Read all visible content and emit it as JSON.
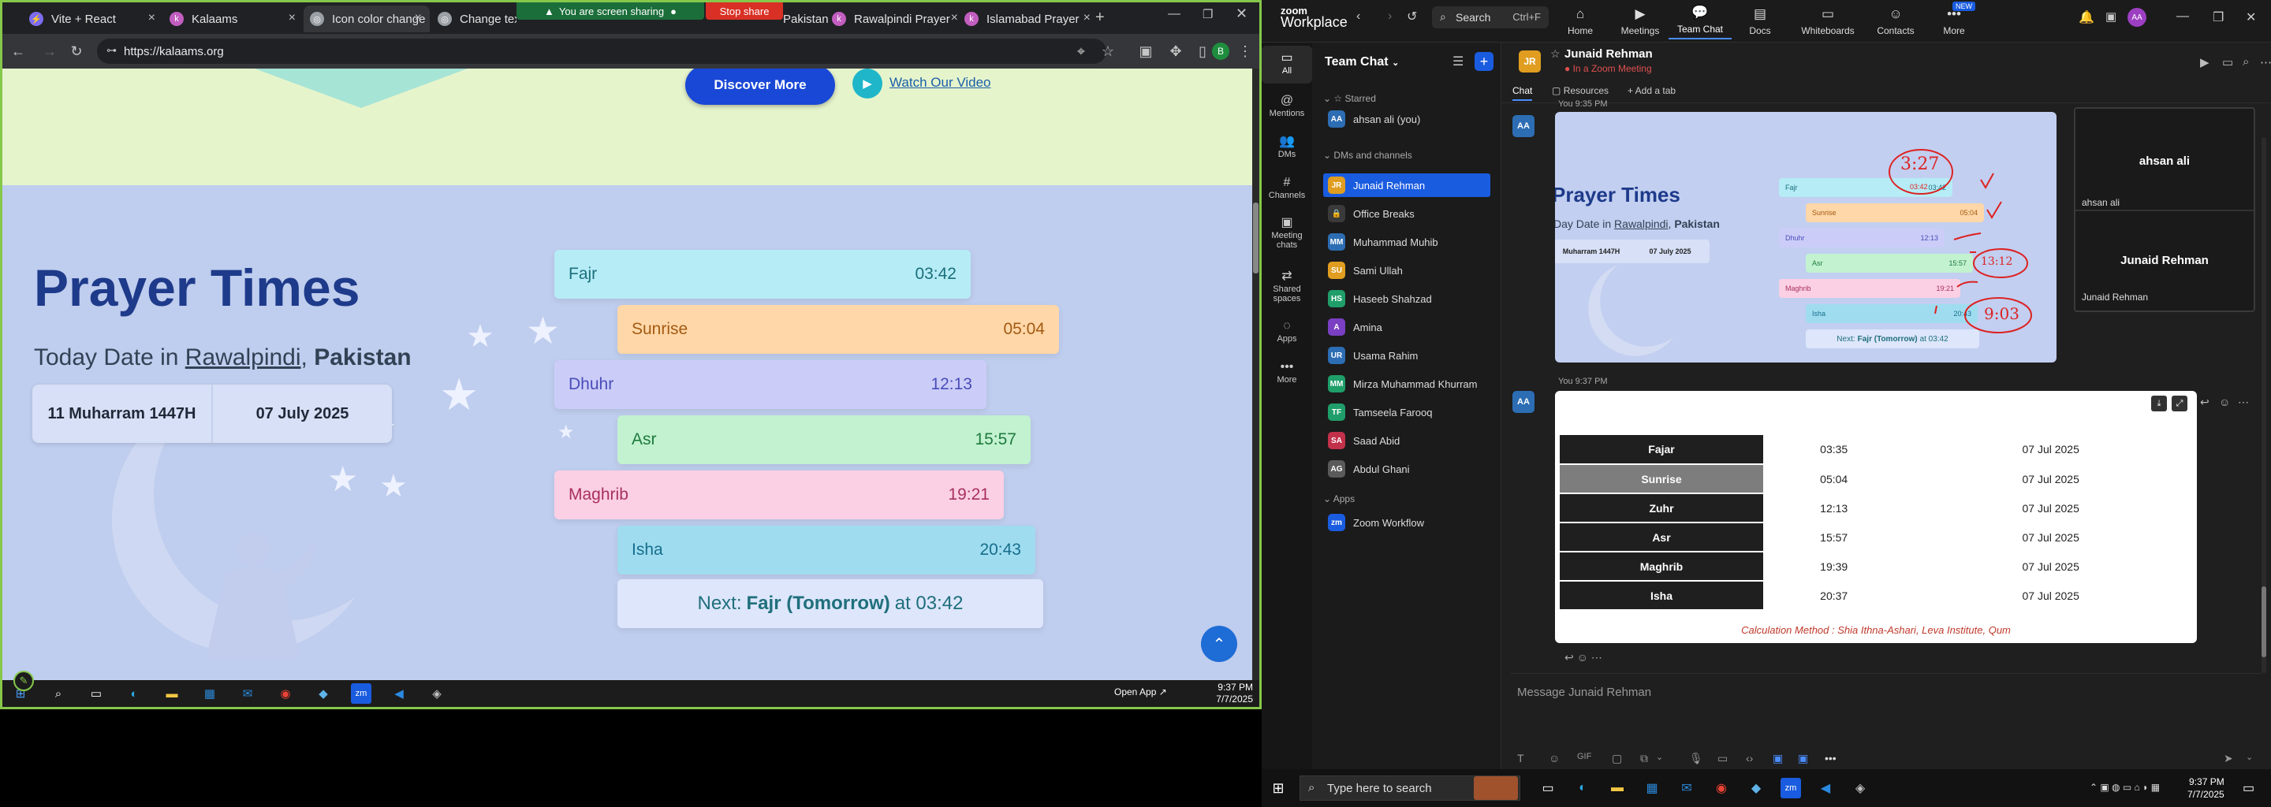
{
  "browser": {
    "tabs": [
      {
        "title": "Vite + React",
        "color": "#7c6cf0"
      },
      {
        "title": "Kalaams",
        "color": "#c25ec0"
      },
      {
        "title": "Icon color change",
        "color": "#9aa0a6"
      },
      {
        "title": "Change text color",
        "color": "#9aa0a6"
      },
      {
        "title": "Pakistan Prayer Ti",
        "color": "#9aa0a6"
      },
      {
        "title": "Rawalpindi Prayer",
        "color": "#c25ec0"
      },
      {
        "title": "Islamabad Prayer",
        "color": "#c25ec0"
      }
    ],
    "sharing_text": "You are screen sharing",
    "stop_share": "Stop share",
    "url": "https://kalaams.org",
    "profile_initial": "B"
  },
  "page": {
    "discover_btn": "Discover More",
    "watch_video": "Watch Our Video",
    "title": "Prayer Times",
    "date_prefix": "Today Date in ",
    "city": "Rawalpindi",
    "comma": ", ",
    "country": "Pakistan",
    "hijri": "11 Muharram 1447H",
    "greg": "07 July 2025",
    "prayers": [
      {
        "name": "Fajr",
        "time": "03:42",
        "bg": "#b6ecf5",
        "color": "#1a6f7c"
      },
      {
        "name": "Sunrise",
        "time": "05:04",
        "bg": "#ffd7a8",
        "color": "#a35a12"
      },
      {
        "name": "Dhuhr",
        "time": "12:13",
        "bg": "#cbcdf8",
        "color": "#4a4db8"
      },
      {
        "name": "Asr",
        "time": "15:57",
        "bg": "#c2f2d0",
        "color": "#1f7a3d"
      },
      {
        "name": "Maghrib",
        "time": "19:21",
        "bg": "#fbd0e4",
        "color": "#a8305f"
      },
      {
        "name": "Isha",
        "time": "20:43",
        "bg": "#9fdcef",
        "color": "#166e8c"
      }
    ],
    "next_label": "Next: ",
    "next_prayer": "Fajr (Tomorrow)",
    "next_at": " at 03:42"
  },
  "left_taskbar": {
    "time": "9:37 PM",
    "date": "7/7/2025",
    "open_app": "Open App ↗"
  },
  "zoom": {
    "brand_top": "zoom",
    "brand": "Workplace",
    "search": "Search",
    "search_shortcut": "Ctrl+F",
    "nav": [
      "Home",
      "Meetings",
      "Team Chat",
      "Docs",
      "Whiteboards",
      "Contacts",
      "More"
    ],
    "new_badge": "NEW",
    "avatar_initials": "AA",
    "rail": [
      "All",
      "Mentions",
      "DMs",
      "Channels",
      "Meeting chats",
      "Shared spaces",
      "Apps",
      "More"
    ],
    "list_title": "Team Chat",
    "sections": {
      "starred": "Starred",
      "dms": "DMs and channels",
      "apps": "Apps"
    },
    "starred": [
      {
        "name": "ahsan ali (you)",
        "initials": "AA",
        "color": "#2c6db3"
      }
    ],
    "contacts": [
      {
        "name": "Junaid Rehman",
        "initials": "JR",
        "color": "#e09d1f"
      },
      {
        "name": "Office Breaks",
        "initials": "🔒",
        "color": "#3a3a3a"
      },
      {
        "name": "Muhammad Muhib",
        "initials": "MM",
        "color": "#2c6db3"
      },
      {
        "name": "Sami Ullah",
        "initials": "SU",
        "color": "#e09d1f"
      },
      {
        "name": "Haseeb Shahzad",
        "initials": "HS",
        "color": "#1f9e6a"
      },
      {
        "name": "Amina",
        "initials": "A",
        "color": "#7a3fc2"
      },
      {
        "name": "Usama Rahim",
        "initials": "UR",
        "color": "#2c6db3"
      },
      {
        "name": "Mirza Muhammad Khurram",
        "initials": "MM",
        "color": "#1f9e6a"
      },
      {
        "name": "Tamseela Farooq",
        "initials": "TF",
        "color": "#1f9e6a"
      },
      {
        "name": "Saad Abid",
        "initials": "SA",
        "color": "#c2304a"
      },
      {
        "name": "Abdul Ghani",
        "initials": "AG",
        "color": "#5a5a5a"
      }
    ],
    "apps": [
      {
        "name": "Zoom Workflow",
        "initials": "zm",
        "color": "#1a5ce0"
      }
    ],
    "chat_name": "Junaid Rehman",
    "chat_status": "In a Zoom Meeting",
    "chat_tabs": [
      "Chat",
      "Resources",
      "+ Add a tab"
    ],
    "msg1_time": "You 9:35 PM",
    "msg2_time": "You 9:37 PM",
    "shot1": {
      "title": "Prayer Times",
      "sub_prefix": "Day Date in ",
      "city": "Rawalpindi",
      "country": "Pakistan",
      "hijri": "Muharram 1447H",
      "greg": "07 July 2025",
      "rows": [
        {
          "name": "Fajr",
          "time": "03:42"
        },
        {
          "name": "Sunrise",
          "time": "05:04"
        },
        {
          "name": "Dhuhr",
          "time": "12:13"
        },
        {
          "name": "Asr",
          "time": "15:57"
        },
        {
          "name": "Maghrib",
          "time": "19:21"
        },
        {
          "name": "Isha",
          "time": "20:43"
        }
      ],
      "next": "Next: ",
      "next_prayer": "Fajr (Tomorrow)",
      "next_at": " at 03:42",
      "ann1": "3:27",
      "ann1_small": "03:42",
      "ann2": "13:12",
      "ann3": "9:03"
    },
    "shot2": {
      "name_top": "ahsan ali",
      "label_top": "ahsan ali",
      "name_bottom": "Junaid Rehman",
      "label_bottom": "Junaid Rehman"
    },
    "table": [
      {
        "name": "Fajar",
        "time": "03:35",
        "date": "07 Jul 2025"
      },
      {
        "name": "Sunrise",
        "time": "05:04",
        "date": "07 Jul 2025"
      },
      {
        "name": "Zuhr",
        "time": "12:13",
        "date": "07 Jul 2025"
      },
      {
        "name": "Asr",
        "time": "15:57",
        "date": "07 Jul 2025"
      },
      {
        "name": "Maghrib",
        "time": "19:39",
        "date": "07 Jul 2025"
      },
      {
        "name": "Isha",
        "time": "20:37",
        "date": "07 Jul 2025"
      }
    ],
    "calc_method": "Calculation Method : Shia Ithna-Ashari, Leva Institute, Qum",
    "compose_placeholder": "Message Junaid Rehman"
  },
  "taskbar": {
    "search_placeholder": "Type here to search",
    "time": "9:37 PM",
    "date": "7/7/2025"
  }
}
